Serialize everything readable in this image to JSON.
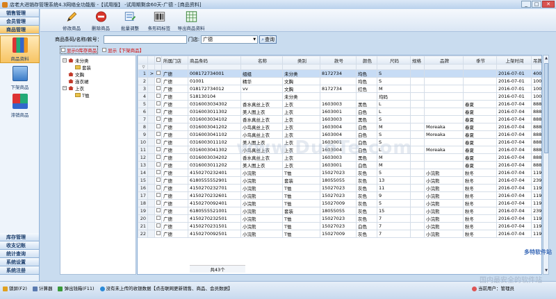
{
  "window": {
    "title": "店老大进销存管理系统4.3网络全功能版 -【试用版】 -试用期剩余60天-广德 - [商品资料]"
  },
  "leftnav": {
    "headers_top": [
      "销售管理",
      "会员管理",
      "商品管理"
    ],
    "buttons": [
      {
        "label": "商品资料",
        "icon": "books-icon",
        "selected": true
      },
      {
        "label": "下架商品",
        "icon": "box-icon",
        "selected": false
      },
      {
        "label": "滞销商品",
        "icon": "blocks-icon",
        "selected": false
      }
    ],
    "headers_bottom": [
      "库存管理",
      "收支记账",
      "统计查询",
      "系统设置",
      "系统注册"
    ]
  },
  "toolbar": {
    "buttons": [
      {
        "label": "修改商品",
        "icon": "pencil-icon"
      },
      {
        "label": "删除商品",
        "icon": "delete-icon"
      },
      {
        "label": "批量调整",
        "icon": "batch-edit-icon"
      },
      {
        "label": "条形码标签",
        "icon": "barcode-icon"
      },
      {
        "label": "导出商品资料",
        "icon": "excel-export-icon"
      }
    ]
  },
  "search": {
    "code_label": "商品条码/名称/款号：",
    "code_value": "",
    "store_label": "门店:",
    "store_value": "广德",
    "query_label": "查询"
  },
  "filters": {
    "show_zero_stock": "显示0库存商品",
    "show_delisted": "显示【下架商品】"
  },
  "tree": {
    "nodes": [
      {
        "label": "未分类",
        "level": 0
      },
      {
        "label": "套装",
        "level": 1
      },
      {
        "label": "文胸",
        "level": 0
      },
      {
        "label": "连衣裙",
        "level": 0
      },
      {
        "label": "上衣",
        "level": 0
      },
      {
        "label": "T恤",
        "level": 1
      }
    ]
  },
  "grid": {
    "columns": [
      "所属门店",
      "商品条码",
      "名称",
      "类别",
      "款号",
      "颜色",
      "尺码",
      "规格",
      "品牌",
      "季节",
      "上架时间",
      "吊牌价"
    ],
    "rows": [
      [
        "广德",
        "008172734001",
        "组组",
        "未分类",
        "8172734",
        "均色",
        "S",
        "",
        "",
        "",
        "2016-07-01",
        "400"
      ],
      [
        "广德",
        "01001",
        "精华",
        "文胸",
        "",
        "均色",
        "S",
        "",
        "",
        "",
        "2016-07-01",
        "100"
      ],
      [
        "广德",
        "018172734012",
        "vv",
        "文胸",
        "8172734",
        "红色",
        "M",
        "",
        "",
        "",
        "2016-07-01",
        "100"
      ],
      [
        "广德",
        "518130104",
        "",
        "未分类",
        "",
        "",
        "均码",
        "",
        "",
        "",
        "2016-07-01",
        "100"
      ],
      [
        "广德",
        "0316003034302",
        "香水真丝上衣",
        "上衣",
        "1603003",
        "黑色",
        "L",
        "",
        "",
        "春夏",
        "2016-07-04",
        "888"
      ],
      [
        "广德",
        "0316003011302",
        "美人图上衣",
        "上衣",
        "1603001",
        "白色",
        "L",
        "",
        "",
        "春夏",
        "2016-07-04",
        "888"
      ],
      [
        "广德",
        "0316003034102",
        "香水真丝上衣",
        "上衣",
        "1603003",
        "黑色",
        "S",
        "",
        "",
        "春夏",
        "2016-07-04",
        "888"
      ],
      [
        "广德",
        "0316003041202",
        "小鸟真丝上衣",
        "上衣",
        "1603004",
        "白色",
        "M",
        "",
        "Moreaka",
        "春夏",
        "2016-07-04",
        "888"
      ],
      [
        "广德",
        "0316003041102",
        "小鸟真丝上衣",
        "上衣",
        "1603004",
        "白色",
        "S",
        "",
        "Moreaka",
        "春夏",
        "2016-07-04",
        "888"
      ],
      [
        "广德",
        "0316003011102",
        "美人图上衣",
        "上衣",
        "1603001",
        "白色",
        "S",
        "",
        "",
        "春夏",
        "2016-07-04",
        "888"
      ],
      [
        "广德",
        "0316003041302",
        "小鸟真丝上衣",
        "上衣",
        "1603004",
        "白色",
        "L",
        "",
        "Moreaka",
        "春夏",
        "2016-07-04",
        "888"
      ],
      [
        "广德",
        "0316003034202",
        "香水真丝上衣",
        "上衣",
        "1603003",
        "黑色",
        "M",
        "",
        "",
        "春夏",
        "2016-07-04",
        "888"
      ],
      [
        "广德",
        "0316003011202",
        "美人图上衣",
        "上衣",
        "1603001",
        "白色",
        "M",
        "",
        "",
        "春夏",
        "2016-07-04",
        "888"
      ],
      [
        "广德",
        "4150270232401",
        "小浣熊",
        "T恤",
        "15027023",
        "灰色",
        "5",
        "",
        "小浣熊",
        "秋冬",
        "2016-07-04",
        "119"
      ],
      [
        "广德",
        "6180555552901",
        "小浣熊",
        "套装",
        "18055055",
        "灰色",
        "13",
        "",
        "小浣熊",
        "秋冬",
        "2016-07-04",
        "239"
      ],
      [
        "广德",
        "4150270232701",
        "小浣熊",
        "T恤",
        "15027023",
        "灰色",
        "11",
        "",
        "小浣熊",
        "秋冬",
        "2016-07-04",
        "119"
      ],
      [
        "广德",
        "4150270232601",
        "小浣熊",
        "T恤",
        "15027023",
        "灰色",
        "9",
        "",
        "小浣熊",
        "秋冬",
        "2016-07-04",
        "119"
      ],
      [
        "广德",
        "4150270092401",
        "小浣熊",
        "T恤",
        "15027009",
        "灰色",
        "5",
        "",
        "小浣熊",
        "秋冬",
        "2016-07-04",
        "119"
      ],
      [
        "广德",
        "6180555521001",
        "小浣熊",
        "套装",
        "18055055",
        "灰色",
        "15",
        "",
        "小浣熊",
        "秋冬",
        "2016-07-04",
        "239"
      ],
      [
        "广德",
        "4150270232501",
        "小浣熊",
        "T恤",
        "15027023",
        "灰色",
        "7",
        "",
        "小浣熊",
        "秋冬",
        "2016-07-04",
        "119"
      ],
      [
        "广德",
        "4150270231501",
        "小浣熊",
        "T恤",
        "15027023",
        "白色",
        "7",
        "",
        "小浣熊",
        "秋冬",
        "2016-07-04",
        "119"
      ],
      [
        "广德",
        "4150270092501",
        "小浣熊",
        "T恤",
        "15027009",
        "灰色",
        "7",
        "",
        "小浣熊",
        "秋冬",
        "2016-07-04",
        "119"
      ]
    ],
    "total": "共43个"
  },
  "statusbar": {
    "items": [
      {
        "label": "锁屏(F2)",
        "icon": "lock-icon"
      },
      {
        "label": "计算器",
        "icon": "calculator-icon"
      },
      {
        "label": "弹出钱箱(F11)",
        "icon": "cash-drawer-icon"
      },
      {
        "label": "没有未上传的收银数据【点击联网更新销售、商品、会员数据】",
        "icon": "upload-icon"
      }
    ],
    "current_user": "当前用户：管理员"
  },
  "watermark": {
    "text1": "www.DuoTe.com",
    "text2": "多特软件站",
    "text3": "国内最安全的软件站"
  },
  "colors": {
    "accent": "#f5c264",
    "header_blue": "#1c3e6c",
    "selection": "#c7dcf5",
    "warning_red": "#d20000"
  }
}
